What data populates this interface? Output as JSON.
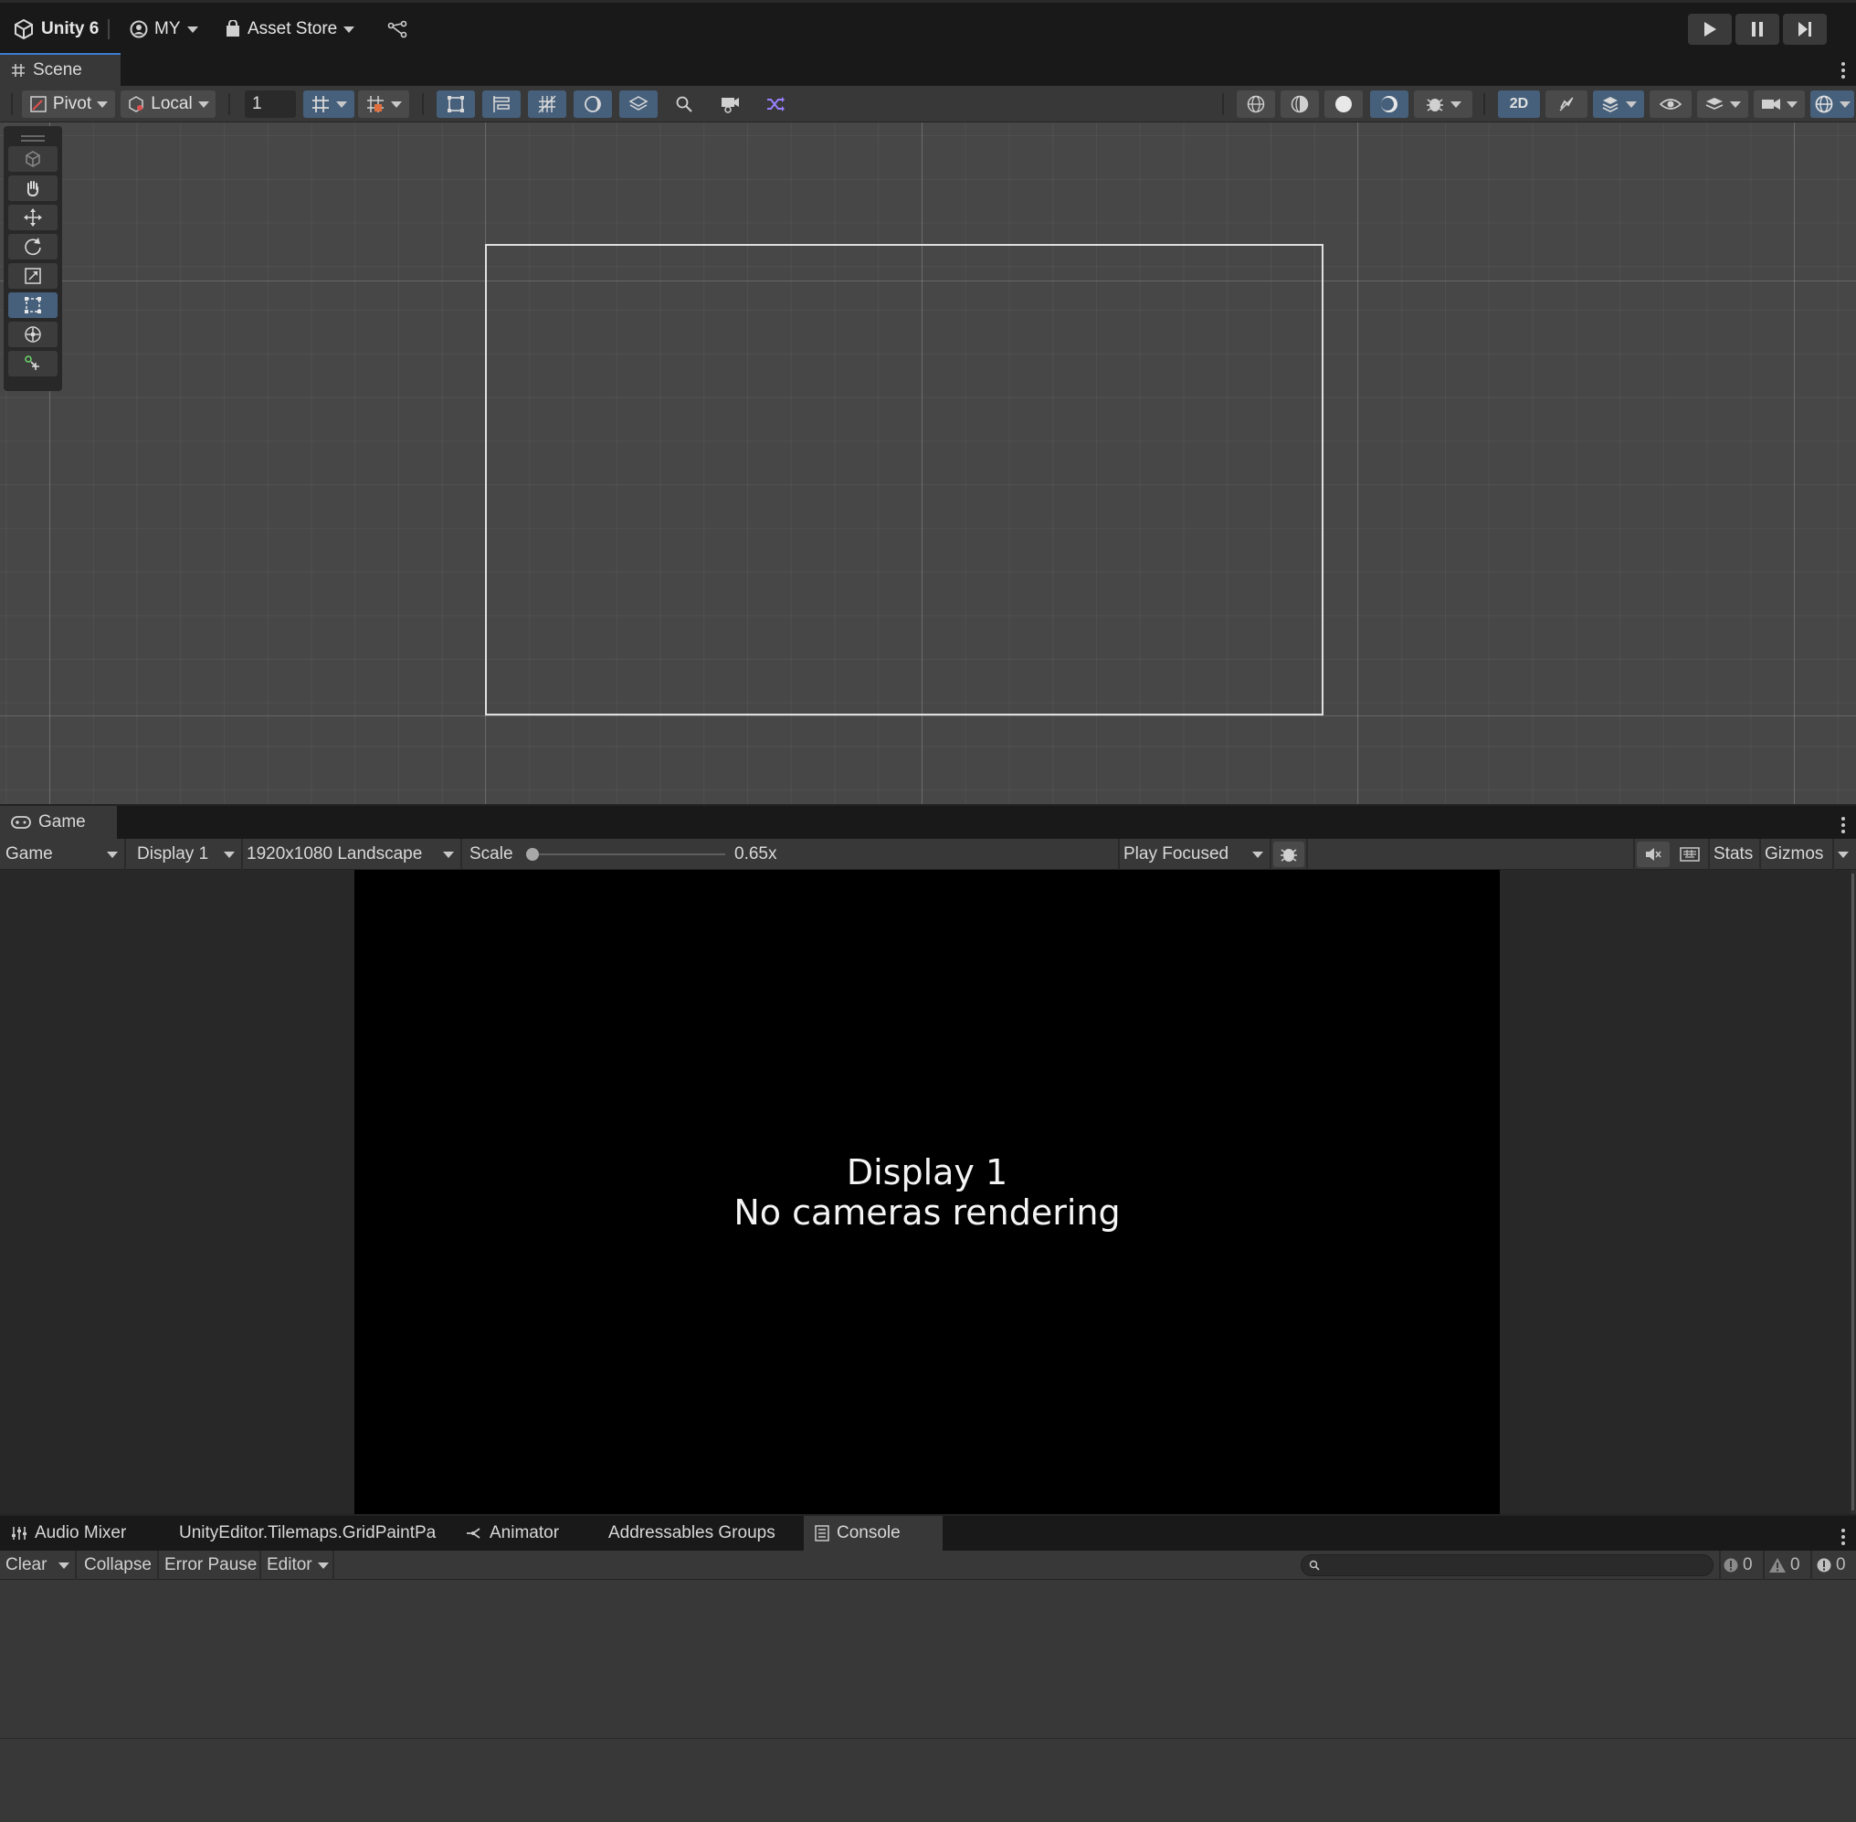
{
  "app": {
    "name": "Unity 6",
    "account": "MY",
    "asset_store": "Asset Store"
  },
  "scene": {
    "tab_label": "Scene",
    "pivot_label": "Pivot",
    "local_label": "Local",
    "grid_snap_value": "1",
    "mode_2d_label": "2D"
  },
  "game": {
    "tab_label": "Game",
    "view_select": "Game",
    "display_select": "Display 1",
    "resolution_select": "1920x1080 Landscape",
    "scale_label": "Scale",
    "scale_value": "0.65x",
    "scale_fraction": 0.0,
    "play_mode_select": "Play Focused",
    "stats_label": "Stats",
    "gizmos_label": "Gizmos",
    "screen_line1": "Display 1",
    "screen_line2": "No cameras rendering"
  },
  "bottom_tabs": [
    {
      "label": "Audio Mixer",
      "icon": "mixer-icon"
    },
    {
      "label": "UnityEditor.Tilemaps.GridPaintPa",
      "icon": ""
    },
    {
      "label": "Animator",
      "icon": "animator-icon"
    },
    {
      "label": "Addressables Groups",
      "icon": ""
    },
    {
      "label": "Console",
      "icon": "console-icon",
      "active": true
    }
  ],
  "console": {
    "clear_label": "Clear",
    "collapse_label": "Collapse",
    "error_pause_label": "Error Pause",
    "editor_label": "Editor",
    "search_placeholder": "",
    "log_count": "0",
    "warning_count": "0",
    "error_count": "0"
  },
  "colors": {
    "accent": "#3c7dd0",
    "toggle_on": "#46607c",
    "panel": "#383838",
    "scene_bg": "#474747"
  }
}
